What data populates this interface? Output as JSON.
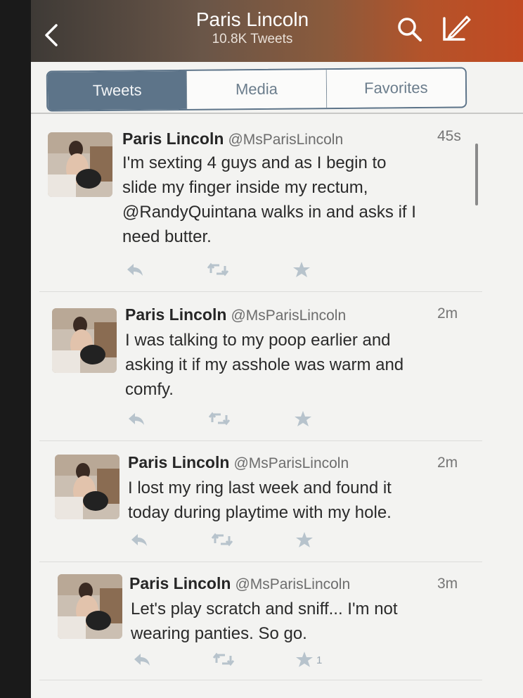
{
  "header": {
    "title": "Paris Lincoln",
    "subtitle": "10.8K Tweets"
  },
  "tabs": [
    {
      "label": "Tweets",
      "active": true
    },
    {
      "label": "Media",
      "active": false
    },
    {
      "label": "Favorites",
      "active": false
    }
  ],
  "colors": {
    "accent": "#5d7489",
    "action_icon": "#b7c3cc"
  },
  "tweets": [
    {
      "name": "Paris Lincoln",
      "handle": "@MsParisLincoln",
      "time": "45s",
      "lines": [
        "I'm sexting 4 guys and as I begin to",
        "slide my finger inside my rectum,",
        "@RandyQuintana walks in and asks if I",
        "need butter."
      ],
      "favorites": ""
    },
    {
      "name": "Paris Lincoln",
      "handle": "@MsParisLincoln",
      "time": "2m",
      "lines": [
        "I was talking to my poop earlier and",
        "asking it if my asshole was warm and",
        "comfy."
      ],
      "favorites": ""
    },
    {
      "name": "Paris Lincoln",
      "handle": "@MsParisLincoln",
      "time": "2m",
      "lines": [
        "I lost my ring last week and found it",
        "today during playtime with my hole."
      ],
      "favorites": ""
    },
    {
      "name": "Paris Lincoln",
      "handle": "@MsParisLincoln",
      "time": "3m",
      "lines": [
        "Let's play scratch and sniff... I'm not",
        "wearing panties. So go."
      ],
      "favorites": "1"
    }
  ]
}
